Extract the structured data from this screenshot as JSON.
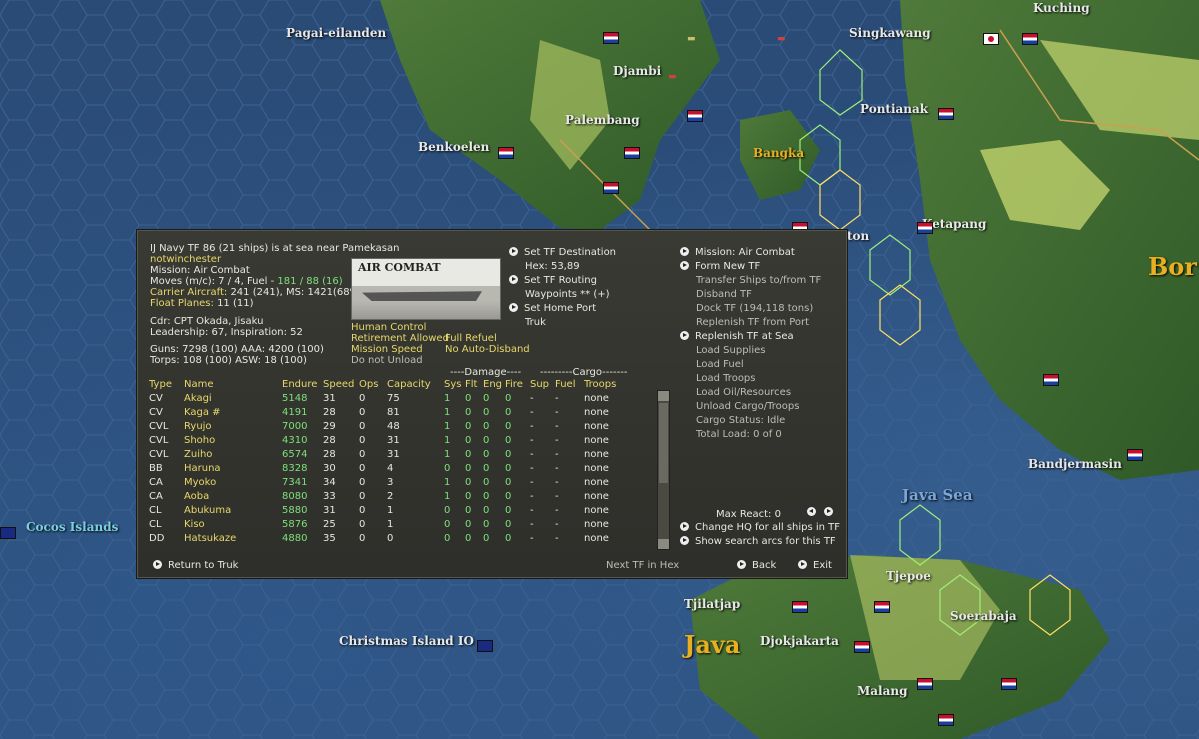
{
  "map": {
    "labels": {
      "kuching": "Kuching",
      "pagai": "Pagai-eilanden",
      "singkawang": "Singkawang",
      "djambi": "Djambi",
      "pontianak": "Pontianak",
      "palembang": "Palembang",
      "benkoelen": "Benkoelen",
      "bangka": "Bangka",
      "ketapang": "Ketapang",
      "borneo": "Bor",
      "bandjermasin": "Bandjermasin",
      "java_sea": "Java Sea",
      "cocos": "Cocos Islands",
      "tjepoe": "Tjepoe",
      "tjilatjap": "Tjilatjap",
      "christmas": "Christmas Island IO",
      "java": "Java",
      "djokjakarta": "Djokjakarta",
      "soerabaja": "Soerabaja",
      "malang": "Malang",
      "ton": "ton"
    }
  },
  "panel": {
    "header": "IJ Navy TF 86 (21 ships) is at sea near Pamekasan",
    "player": "notwinchester",
    "mission": "Mission: Air Combat",
    "moves_prefix": "Moves (m/c): 7 / 4, Fuel - ",
    "moves_fuel": "181 / 88 (16)",
    "carrier_label": "Carrier Aircraft:",
    "carrier_value": " 241 (241), MS: 1421(68%)",
    "float_label": "Float Planes:",
    "float_value": " 11 (11)",
    "cdr": "Cdr: CPT Okada, Jisaku",
    "leadership": "Leadership: 67, Inspiration: 52",
    "guns": "Guns: 7298 (100)   AAA: 4200 (100)",
    "torps": "Torps: 108 (100)   ASW: 18 (100)",
    "image_title": "AIR COMBAT",
    "opts": {
      "human": "Human Control",
      "retire": "Retirement Allowed",
      "refuel": "Full Refuel",
      "speed": "Mission Speed",
      "disband": "No Auto-Disband",
      "unload": "Do not Unload"
    },
    "mid": {
      "dest": "Set TF Destination",
      "hex": "Hex: 53,89",
      "routing": "Set TF Routing",
      "waypoints": "Waypoints ** (+)",
      "home": "Set Home Port",
      "truk": "Truk"
    },
    "right": {
      "mission": "Mission: Air Combat",
      "form": "Form New TF",
      "transfer": "Transfer Ships to/from TF",
      "disband": "Disband TF",
      "dock": "Dock TF (194,118 tons)",
      "replenish_port": "Replenish TF from Port",
      "replenish_sea": "Replenish TF at Sea",
      "supplies": "Load Supplies",
      "fuel": "Load Fuel",
      "troops": "Load Troops",
      "oil": "Load Oil/Resources",
      "unload": "Unload Cargo/Troops",
      "cargo_status": "Cargo Status: Idle",
      "total_load": "Total Load: 0 of 0",
      "max_react": "Max React:  0",
      "change_hq": "Change HQ for all ships in TF",
      "search_arcs": "Show search arcs for this TF"
    },
    "group_headers": {
      "damage": "----Damage----",
      "cargo": "---------Cargo-------"
    },
    "columns": [
      "Type",
      "Name",
      "Endure",
      "Speed",
      "Ops",
      "Capacity",
      "Sys",
      "Flt",
      "Eng",
      "Fire",
      "Sup",
      "Fuel",
      "Troops"
    ],
    "ships": [
      [
        "CV",
        "Akagi",
        "5148",
        "31",
        "0",
        "75",
        "1",
        "0",
        "0",
        "0",
        "-",
        "-",
        "none"
      ],
      [
        "CV",
        "Kaga #",
        "4191",
        "28",
        "0",
        "81",
        "1",
        "0",
        "0",
        "0",
        "-",
        "-",
        "none"
      ],
      [
        "CVL",
        "Ryujo",
        "7000",
        "29",
        "0",
        "48",
        "1",
        "0",
        "0",
        "0",
        "-",
        "-",
        "none"
      ],
      [
        "CVL",
        "Shoho",
        "4310",
        "28",
        "0",
        "31",
        "1",
        "0",
        "0",
        "0",
        "-",
        "-",
        "none"
      ],
      [
        "CVL",
        "Zuiho",
        "6574",
        "28",
        "0",
        "31",
        "1",
        "0",
        "0",
        "0",
        "-",
        "-",
        "none"
      ],
      [
        "BB",
        "Haruna",
        "8328",
        "30",
        "0",
        "4",
        "0",
        "0",
        "0",
        "0",
        "-",
        "-",
        "none"
      ],
      [
        "CA",
        "Myoko",
        "7341",
        "34",
        "0",
        "3",
        "1",
        "0",
        "0",
        "0",
        "-",
        "-",
        "none"
      ],
      [
        "CA",
        "Aoba",
        "8080",
        "33",
        "0",
        "2",
        "1",
        "0",
        "0",
        "0",
        "-",
        "-",
        "none"
      ],
      [
        "CL",
        "Abukuma",
        "5880",
        "31",
        "0",
        "1",
        "0",
        "0",
        "0",
        "0",
        "-",
        "-",
        "none"
      ],
      [
        "CL",
        "Kiso",
        "5876",
        "25",
        "0",
        "1",
        "0",
        "0",
        "0",
        "0",
        "-",
        "-",
        "none"
      ],
      [
        "DD",
        "Hatsukaze",
        "4880",
        "35",
        "0",
        "0",
        "0",
        "0",
        "0",
        "0",
        "-",
        "-",
        "none"
      ]
    ],
    "footer": {
      "return": "Return to Truk",
      "next": "Next TF in Hex",
      "back": "Back",
      "exit": "Exit"
    }
  }
}
